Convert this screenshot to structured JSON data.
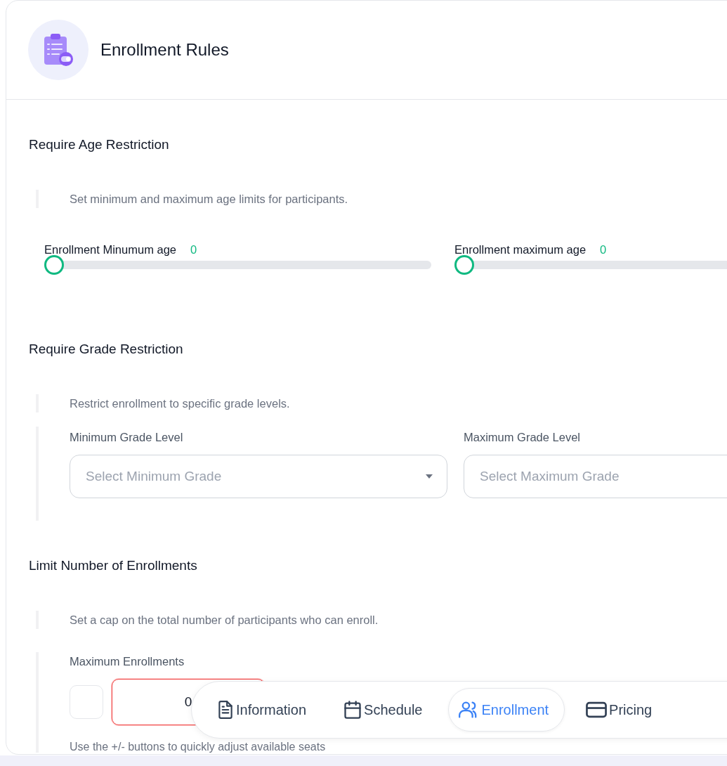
{
  "header": {
    "title": "Enrollment Rules"
  },
  "age_restriction": {
    "title": "Require Age Restriction",
    "description": "Set minimum and maximum age limits for participants.",
    "sliders": [
      {
        "label": "Enrollment Minumum age",
        "reading": "0",
        "level": 0
      },
      {
        "label": "Enrollment maximum age",
        "reading": "0",
        "level": 0
      }
    ]
  },
  "grade_restriction": {
    "title": "Require Grade Restriction",
    "description": "Restrict enrollment to specific grade levels.",
    "selects": [
      {
        "label": "Minimum Grade Level",
        "placeholder": "Select Minimum Grade"
      },
      {
        "label": "Maximum Grade Level",
        "placeholder": "Select Maximum Grade"
      }
    ]
  },
  "enrollment_limit": {
    "title": "Limit Number of Enrollments",
    "description": "Set a cap on the total number of participants who can enroll.",
    "field": {
      "label": "Maximum Enrollments",
      "value": "0",
      "invalid": true
    },
    "hint": "Use the +/- buttons to quickly adjust available seats"
  },
  "nav": [
    {
      "label": "Information",
      "selected": false
    },
    {
      "label": "Schedule",
      "selected": false
    },
    {
      "label": "Enrollment",
      "selected": true
    },
    {
      "label": "Pricing",
      "selected": false
    }
  ]
}
